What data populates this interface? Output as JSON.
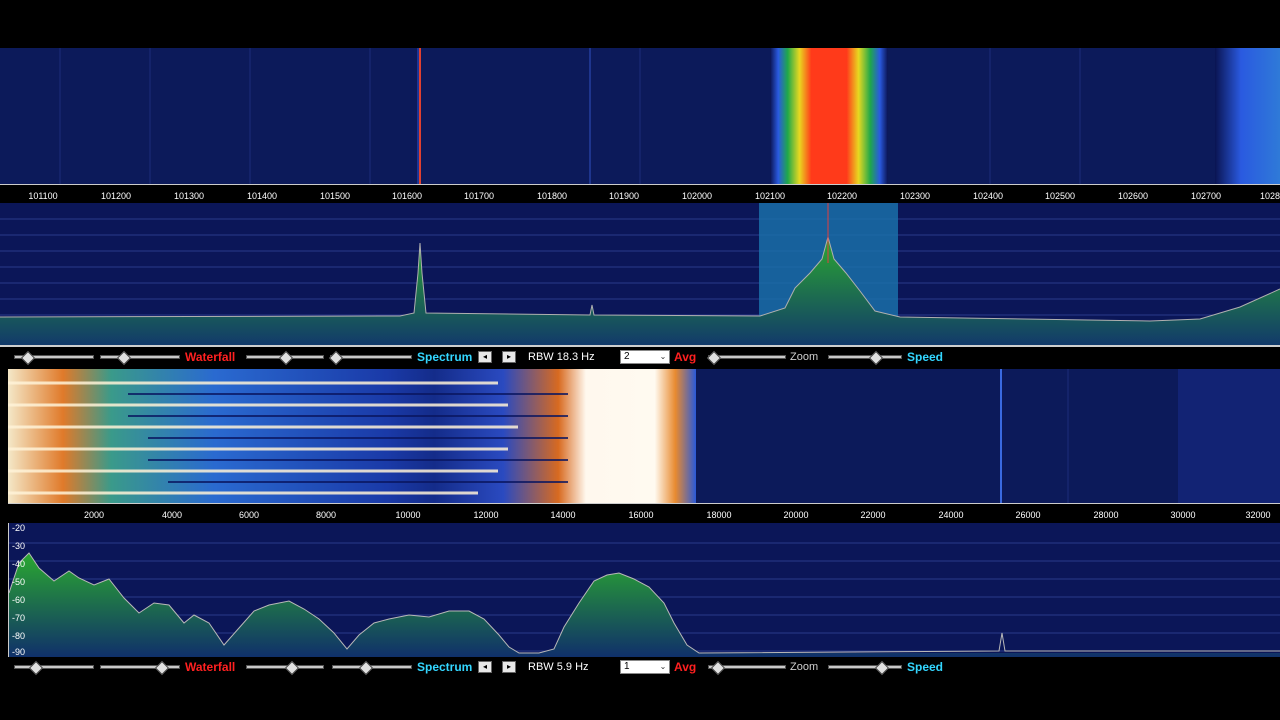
{
  "top_axis": {
    "labels": [
      "101100",
      "101200",
      "101300",
      "101400",
      "101500",
      "101600",
      "101700",
      "101800",
      "101900",
      "102000",
      "102100",
      "102200",
      "102300",
      "102400",
      "102500",
      "102600",
      "102700",
      "1028"
    ]
  },
  "bottom_axis": {
    "labels": [
      "2000",
      "4000",
      "6000",
      "8000",
      "10000",
      "12000",
      "14000",
      "16000",
      "18000",
      "20000",
      "22000",
      "24000",
      "26000",
      "28000",
      "30000",
      "32000"
    ]
  },
  "audio_db_labels": [
    "-20",
    "-30",
    "-40",
    "-50",
    "-60",
    "-70",
    "-80",
    "-90"
  ],
  "controls_top": {
    "waterfall": "Waterfall",
    "spectrum": "Spectrum",
    "rbw": "RBW 18.3 Hz",
    "avg_value": "2",
    "avg": "Avg",
    "zoom": "Zoom",
    "speed": "Speed",
    "prev_icon": "◂",
    "next_icon": "▸",
    "dropdown_icon": "⌄"
  },
  "controls_bottom": {
    "waterfall": "Waterfall",
    "spectrum": "Spectrum",
    "rbw": "RBW  5.9 Hz",
    "avg_value": "1",
    "avg": "Avg",
    "zoom": "Zoom",
    "speed": "Speed",
    "prev_icon": "◂",
    "next_icon": "▸",
    "dropdown_icon": "⌄"
  },
  "colors": {
    "waterfall_bg": "#0a1452",
    "signal_red": "#ff3a1a",
    "spectrum_green": "#1f8a2a",
    "passband": "#1a6fa8",
    "label_red": "#ff2020",
    "label_cyan": "#33d6ff"
  }
}
